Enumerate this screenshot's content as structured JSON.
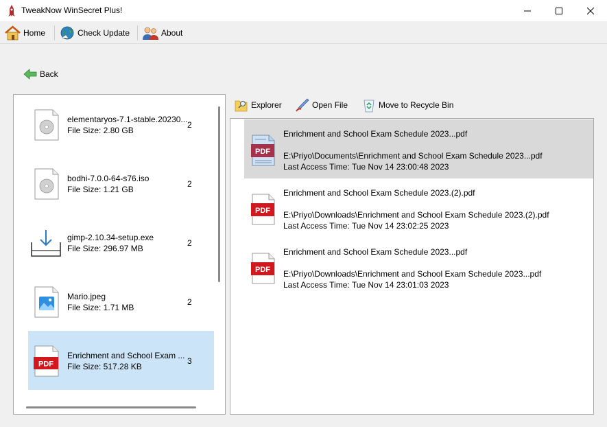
{
  "window": {
    "title": "TweakNow WinSecret Plus!"
  },
  "menu": {
    "home": "Home",
    "check_update": "Check Update",
    "about": "About"
  },
  "nav": {
    "back": "Back"
  },
  "actions": {
    "explorer": "Explorer",
    "open_file": "Open File",
    "recycle": "Move to Recycle Bin"
  },
  "files": [
    {
      "name": "elementaryos-7.1-stable.20230...",
      "size": "File Size: 2.80 GB",
      "count": "2",
      "icon": "disc-image-icon"
    },
    {
      "name": "bodhi-7.0.0-64-s76.iso",
      "size": "File Size: 1.21 GB",
      "count": "2",
      "icon": "disc-image-icon"
    },
    {
      "name": "gimp-2.10.34-setup.exe",
      "size": "File Size: 296.97 MB",
      "count": "2",
      "icon": "download-installer-icon"
    },
    {
      "name": "Mario.jpeg",
      "size": "File Size: 1.71 MB",
      "count": "2",
      "icon": "image-file-icon"
    },
    {
      "name": "Enrichment and School Exam ...",
      "size": "File Size: 517.28 KB",
      "count": "3",
      "icon": "pdf-file-icon",
      "selected": true
    }
  ],
  "duplicates": [
    {
      "name": "Enrichment and School Exam Schedule 2023...pdf",
      "path": "E:\\Priyo\\Documents\\Enrichment and School Exam Schedule 2023...pdf",
      "time": "Last Access Time: Tue Nov 14 23:00:48 2023",
      "selected": true
    },
    {
      "name": "Enrichment and School Exam Schedule 2023.(2).pdf",
      "path": "E:\\Priyo\\Downloads\\Enrichment and School Exam Schedule 2023.(2).pdf",
      "time": "Last Access Time: Tue Nov 14 23:02:25 2023"
    },
    {
      "name": "Enrichment and School Exam Schedule 2023...pdf",
      "path": "E:\\Priyo\\Downloads\\Enrichment and School Exam Schedule 2023...pdf",
      "time": "Last Access Time: Tue Nov 14 23:01:03 2023"
    }
  ],
  "pdf_label": "PDF",
  "colors": {
    "selection_blue": "#cce4f7",
    "selection_gray": "#d9d9d9",
    "pdf_red": "#d0191f"
  }
}
